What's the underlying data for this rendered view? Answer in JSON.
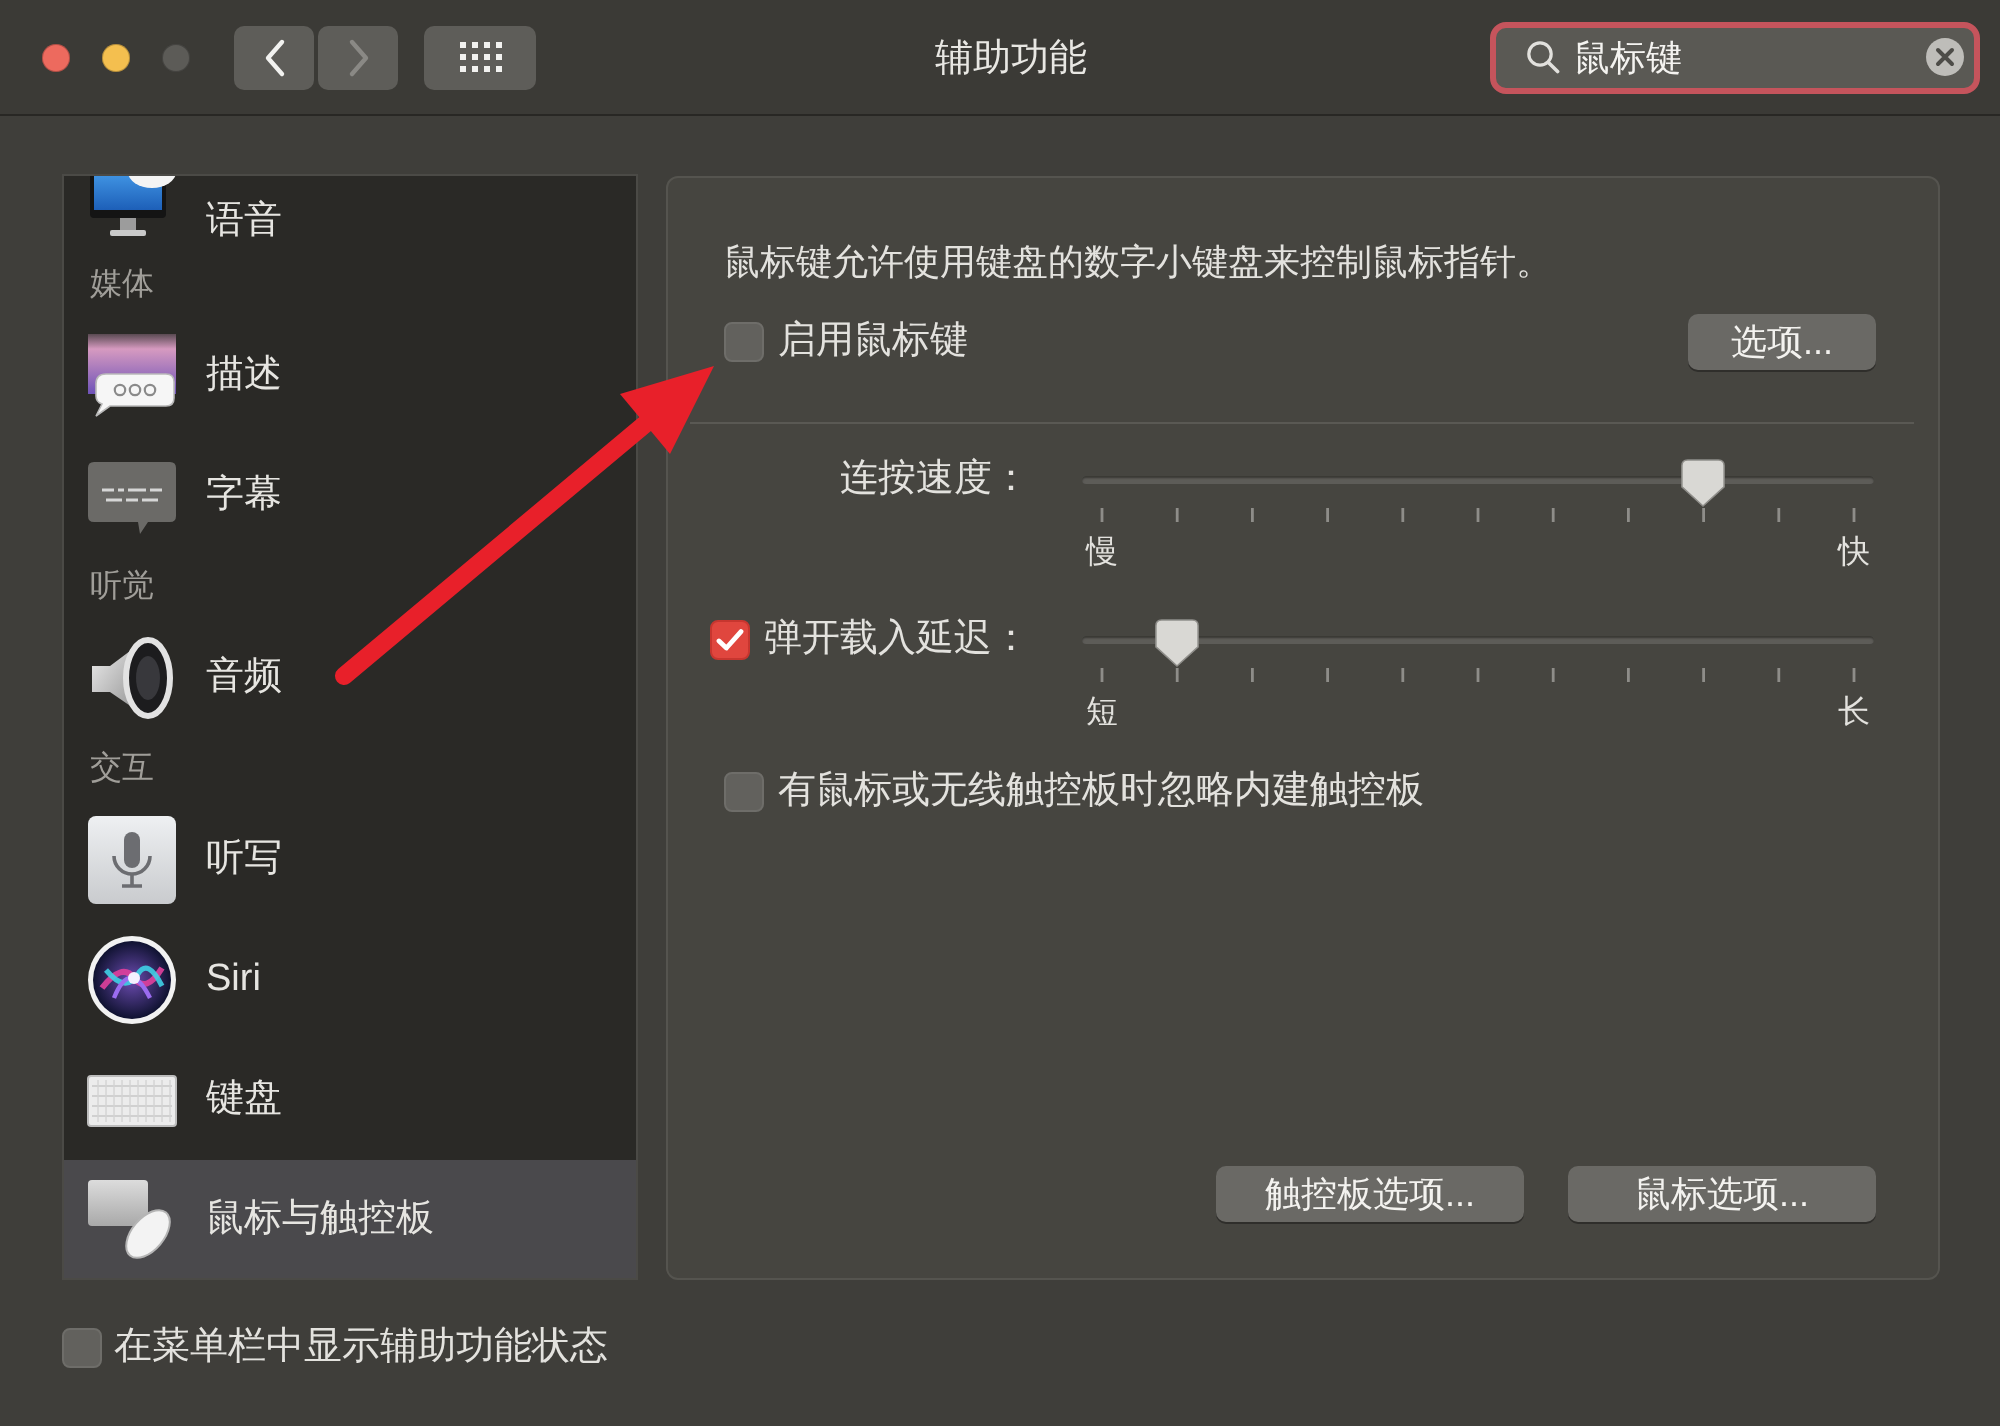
{
  "window": {
    "title": "辅助功能"
  },
  "toolbar": {
    "nav_buttons": [
      {
        "kind": "back",
        "disabled": false
      },
      {
        "kind": "forward",
        "disabled": true
      }
    ],
    "search": {
      "value": "鼠标键"
    }
  },
  "sidebar": {
    "sections": [
      {
        "items": [
          {
            "label": "语音",
            "selected": false
          }
        ]
      },
      {
        "heading": "媒体",
        "items": [
          {
            "label": "描述",
            "selected": false
          },
          {
            "label": "字幕",
            "selected": false
          }
        ]
      },
      {
        "heading": "听觉",
        "items": [
          {
            "label": "音频",
            "selected": false
          }
        ]
      },
      {
        "heading": "交互",
        "items": [
          {
            "label": "听写",
            "selected": false
          },
          {
            "label": "Siri",
            "selected": false
          },
          {
            "label": "键盘",
            "selected": false
          },
          {
            "label": "鼠标与触控板",
            "selected": true
          }
        ]
      }
    ]
  },
  "mouse_keys": {
    "description": "鼠标键允许使用键盘的数字小键盘来控制鼠标指针。",
    "enable": {
      "label": "启用鼠标键",
      "checked": false
    },
    "options_button": "选项...",
    "sliders": [
      {
        "kind": "plain",
        "label": "连按速度：",
        "level": 0.8,
        "min_label": "慢",
        "max_label": "快"
      },
      {
        "kind": "checkbox",
        "label": "弹开载入延迟：",
        "checked": true,
        "level": 0.1,
        "min_label": "短",
        "max_label": "长"
      }
    ],
    "ignore_trackpad": {
      "label": "有鼠标或无线触控板时忽略内建触控板",
      "checked": false
    },
    "buttons": [
      "触控板选项...",
      "鼠标选项..."
    ]
  },
  "footer": {
    "show_status": {
      "label": "在菜单栏中显示辅助功能状态",
      "checked": false
    }
  },
  "annotations": [
    {
      "kind": "arrow"
    }
  ]
}
